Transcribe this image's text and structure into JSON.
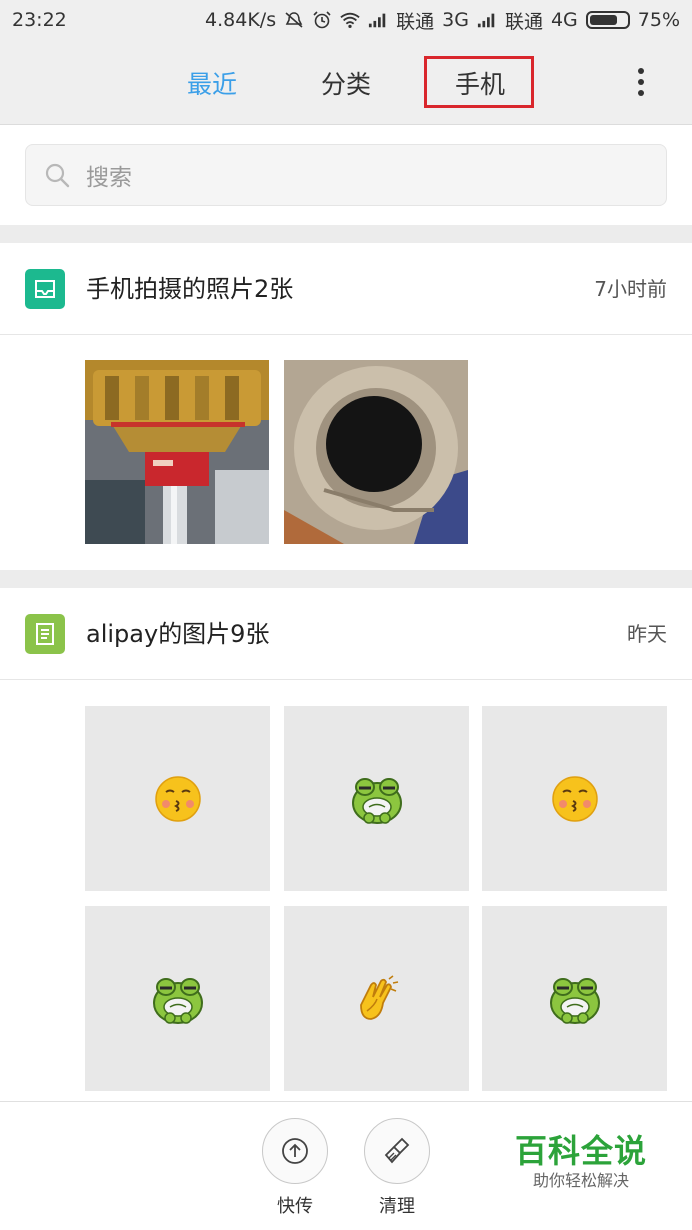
{
  "status_bar": {
    "time": "23:22",
    "speed": "4.84K/s",
    "carrier1": "联通",
    "network1": "3G",
    "carrier2": "联通",
    "network2": "4G",
    "battery_percent": "75%",
    "battery_level": 0.75
  },
  "tabs": [
    {
      "label": "最近",
      "active": true
    },
    {
      "label": "分类",
      "active": false
    },
    {
      "label": "手机",
      "active": false
    }
  ],
  "search": {
    "placeholder": "搜索"
  },
  "sections": [
    {
      "icon": "photo-folder-icon",
      "icon_color": "#1cb98f",
      "title": "手机拍摄的照片2张",
      "time": "7小时前"
    },
    {
      "icon": "document-icon",
      "icon_color": "#8bc34a",
      "title": "alipay的图片9张",
      "time": "昨天"
    }
  ],
  "alipay_thumbnails": [
    "kiss-emoji-icon",
    "frog-emoji-icon",
    "kiss-emoji-icon",
    "frog-emoji-icon",
    "clapping-hands-emoji-icon",
    "frog-emoji-icon"
  ],
  "bottom_bar": {
    "quick_send_label": "快传",
    "clean_label": "清理"
  },
  "watermark": {
    "main": "百科全说",
    "sub": "助你轻松解决"
  },
  "colors": {
    "accent": "#3b9fe8",
    "highlight_box": "#d9262c",
    "watermark": "#2ca33a"
  }
}
